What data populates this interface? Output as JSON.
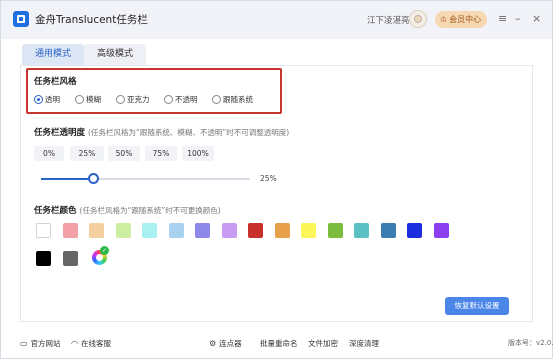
{
  "app": {
    "title": "金舟Translucent任务栏",
    "user_name": "江下凌湛亮",
    "vip_label": "会员中心"
  },
  "title_icons": [
    "menu-icon",
    "minimize-icon",
    "close-icon"
  ],
  "tabs": [
    {
      "label": "通用模式",
      "active": true
    },
    {
      "label": "高级模式",
      "active": false
    }
  ],
  "taskbar_style": {
    "title": "任务栏风格",
    "options": [
      "透明",
      "模糊",
      "亚克力",
      "不透明",
      "跟随系统"
    ],
    "selected": "透明"
  },
  "transparency": {
    "title": "任务栏透明度",
    "note": "(任务栏风格为“跟随系统、模糊、不透明”时不可调整透明度)",
    "presets": [
      "0%",
      "25%",
      "50%",
      "75%",
      "100%"
    ],
    "value": 25,
    "value_label": "25%"
  },
  "color": {
    "title": "任务栏颜色",
    "note": "(任务栏风格为“跟随系统”时不可更换颜色)",
    "swatches": [
      "#ffffff",
      "#f4a0a8",
      "#f6cfa0",
      "#cdeea0",
      "#a9f0f0",
      "#a8d2f0",
      "#8e88e8",
      "#c79cf2",
      "#c9302c",
      "#e8a04a",
      "#fdf65a",
      "#7dbd3e",
      "#5bc0c4",
      "#3a7db0",
      "#1c2ee0",
      "#8a3ef0",
      "#000000",
      "#666666"
    ],
    "accent": "#2a64c6"
  },
  "restore_label": "恢复默认设置",
  "footer": {
    "website": "官方网站",
    "service": "在线客服",
    "tools": [
      "连点器",
      "批量重命名",
      "文件加密",
      "深度清理"
    ],
    "version": "版本号：v2.0.5"
  }
}
